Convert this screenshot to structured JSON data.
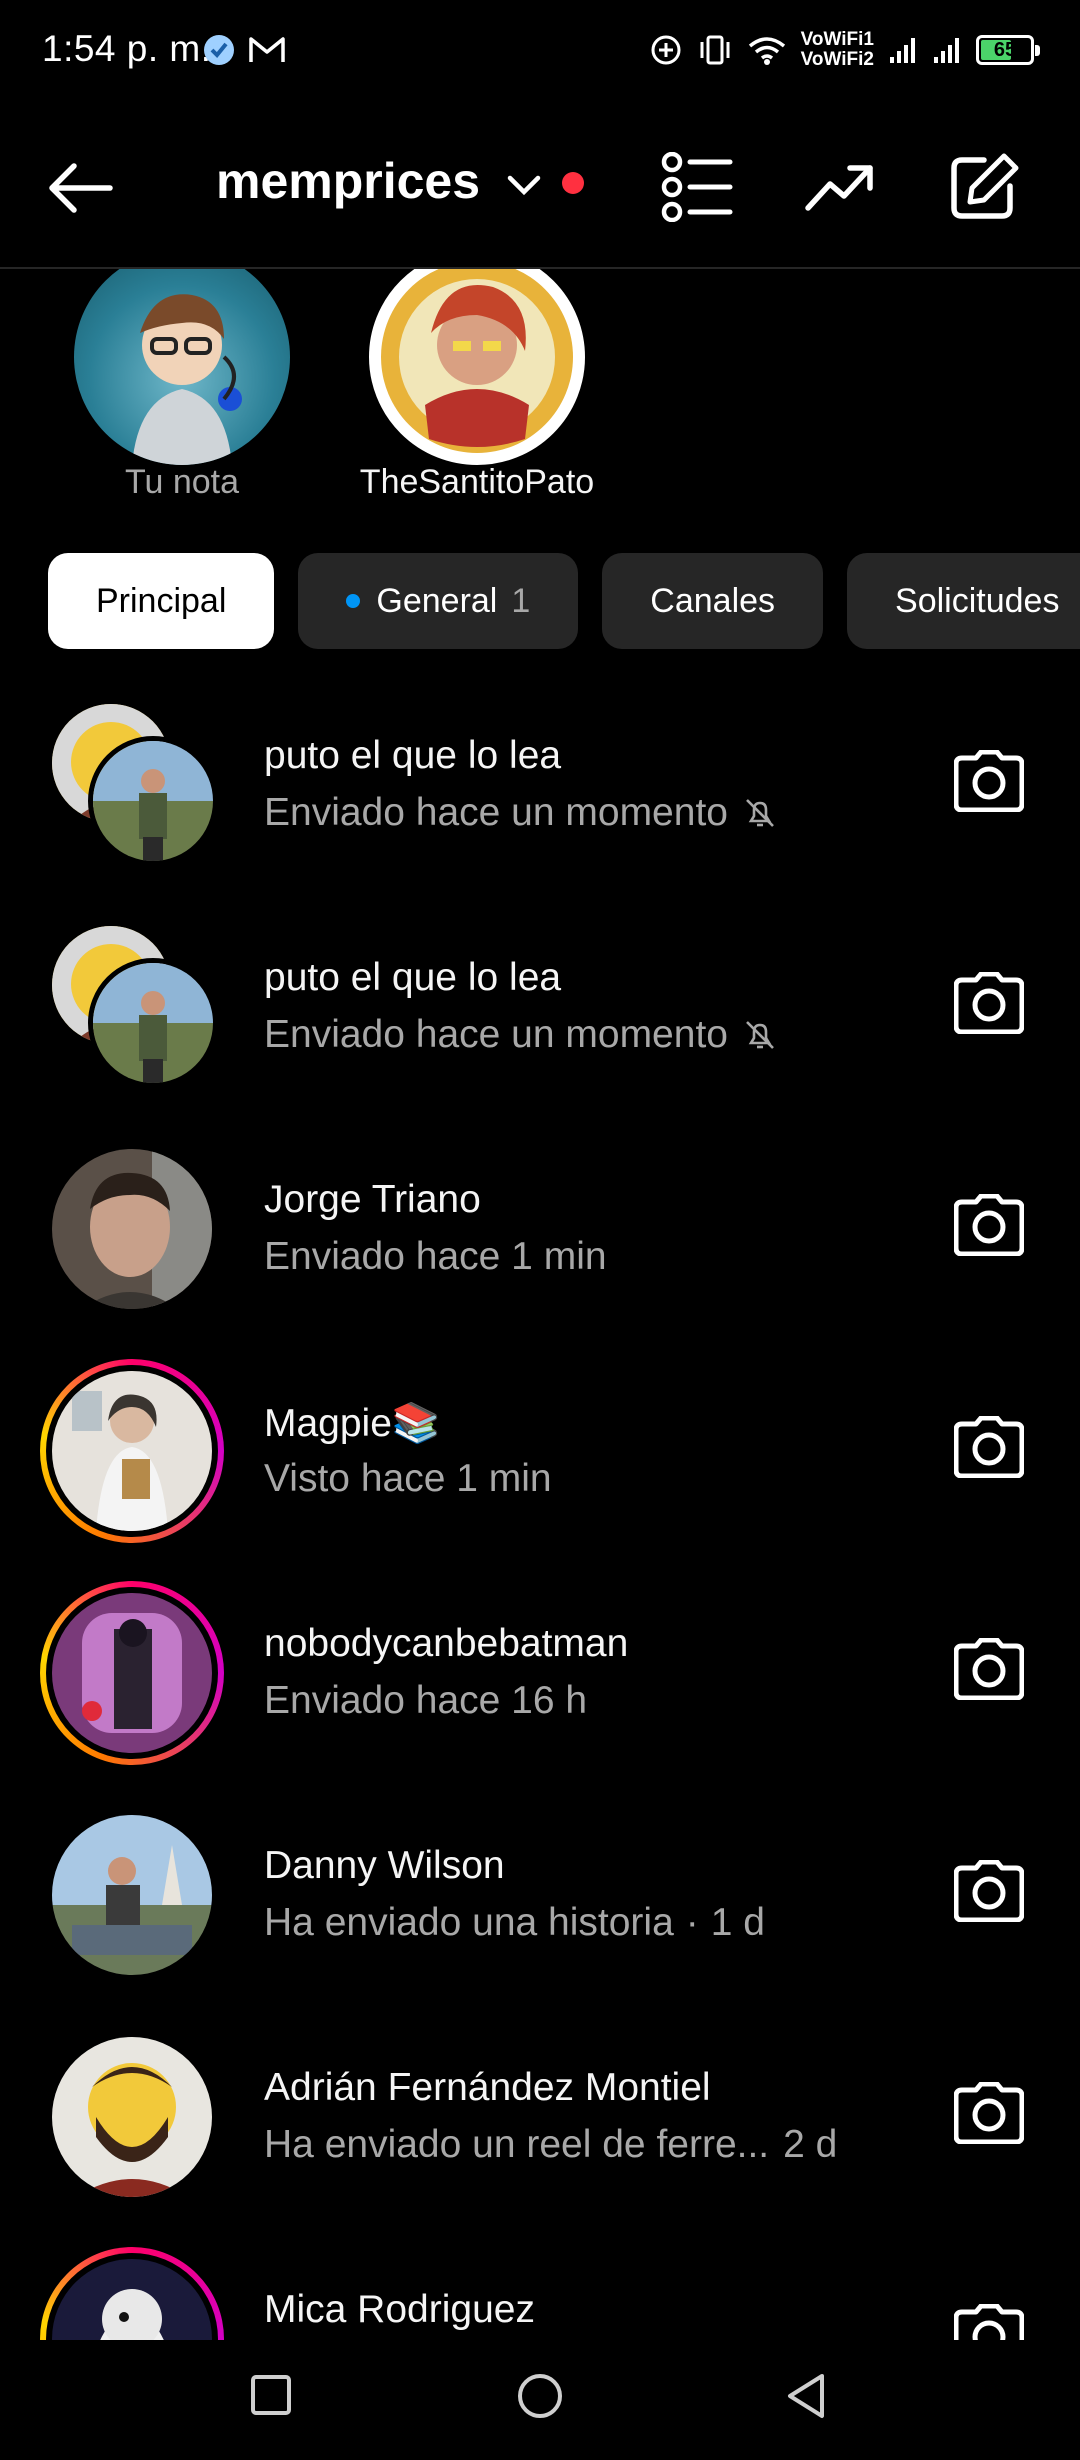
{
  "status_bar": {
    "time": "1:54 p. m.",
    "vowifi_1": "VoWiFi1",
    "vowifi_2": "VoWiFi2",
    "battery": "65",
    "battery_level": 0.65,
    "battery_color": "#4bd46a"
  },
  "header": {
    "account": "memprices",
    "icons": [
      "back-arrow-icon",
      "chevron-down-icon",
      "notification-dot",
      "list-icon",
      "trending-icon",
      "compose-icon"
    ]
  },
  "notes": [
    {
      "label": "Tu nota"
    },
    {
      "label": "TheSantitoPato"
    }
  ],
  "tabs": [
    {
      "label": "Principal",
      "active": true
    },
    {
      "label": "General",
      "count": "1",
      "dot": true
    },
    {
      "label": "Canales"
    },
    {
      "label": "Solicitudes"
    }
  ],
  "chats": [
    {
      "name": "puto el que lo lea",
      "sub": "Enviado hace un momento",
      "muted": true,
      "group": true
    },
    {
      "name": "puto el que lo lea",
      "sub": "Enviado hace un momento",
      "muted": true,
      "group": true
    },
    {
      "name": "Jorge Triano",
      "sub": "Enviado hace 1 min"
    },
    {
      "name": "Magpie📚",
      "sub": "Visto hace 1 min",
      "story": true
    },
    {
      "name": "nobodycanbebatman",
      "sub": "Enviado hace 16 h",
      "story": true
    },
    {
      "name": "Danny Wilson",
      "sub": "Ha enviado una historia",
      "sep": "·",
      "time": "1 d"
    },
    {
      "name": "Adrián Fernández Montiel",
      "sub": "Ha enviado un reel de ferre...",
      "time": "2 d"
    },
    {
      "name": "Mica Rodriguez",
      "sub": "",
      "story": true
    }
  ],
  "colors": {
    "background": "#000000",
    "tab_bg": "#262626",
    "tab_active_bg": "#ffffff",
    "secondary_text": "#a8a8a8",
    "accent_blue": "#0095f6",
    "notification_red": "#ff3040"
  }
}
